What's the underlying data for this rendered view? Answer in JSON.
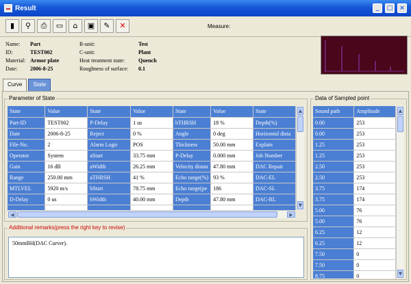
{
  "window": {
    "title": "Result"
  },
  "toolbar": {
    "measure_label": "Measure:"
  },
  "info": {
    "name_label": "Name:",
    "name": "Part",
    "id_label": "ID:",
    "id": "TEST002",
    "material_label": "Material:",
    "material": "Armor plate",
    "date_label": "Date:",
    "date": "2006-8-25",
    "runit_label": "R-unit:",
    "runit": "Test",
    "cunit_label": "C-unit:",
    "cunit": "Plant",
    "heat_label": "Heat treatment state:",
    "heat": "Quench",
    "rough_label": "Roughness of surface:",
    "rough": "0.1"
  },
  "tabs": {
    "curve": "Curve",
    "state": "State"
  },
  "param": {
    "legend": "Parameter of State",
    "headers": [
      "State",
      "Value",
      "State",
      "Value",
      "State",
      "Value",
      "State"
    ],
    "rows": [
      [
        "Part-ID",
        "TEST002",
        "P-Delay",
        "1 us",
        "bTHRSH",
        "18 %",
        "Depth(%)"
      ],
      [
        "Date",
        "2006-8-25",
        "Reject",
        "0 %",
        "Angle",
        "0 deg",
        "Horizontal dista"
      ],
      [
        "File-No.",
        "2",
        "Alarm Logic",
        "POS",
        "Thickness",
        "50.00 mm",
        "Explain"
      ],
      [
        "Operator",
        "System",
        "aStart",
        "33.75 mm",
        "P-Delay",
        "0.000 mm",
        "Job Number"
      ],
      [
        "Gain",
        "16 dB",
        "aWidth",
        "26.25 mm",
        "Velocity distan",
        "47.80 mm",
        "DAC Repair"
      ],
      [
        "Range",
        "250.00 mm",
        "aTHRSH",
        "41 %",
        "Echo range(%)",
        "93 %",
        "DAC-EL"
      ],
      [
        "MTLVEL",
        "5920 m/s",
        "bStart",
        "78.75 mm",
        "Echo range(pe",
        "186",
        "DAC-SL"
      ],
      [
        "D-Delay",
        "0 us",
        "bWidth",
        "40.00 mm",
        "Depth",
        "47.80 mm",
        "DAC-RL"
      ],
      [
        "",
        "",
        "",
        "",
        "",
        "",
        ""
      ]
    ]
  },
  "remarks": {
    "legend": "Additional remarks(press the right key to revise)",
    "text": "50mmBH(DAC Curver)."
  },
  "sampled": {
    "legend": "Data of Sampled point",
    "headers": [
      "Sound path",
      "Amplitude"
    ],
    "rows": [
      [
        "0.00",
        "253"
      ],
      [
        "0.00",
        "253"
      ],
      [
        "1.25",
        "253"
      ],
      [
        "1.25",
        "253"
      ],
      [
        "2.50",
        "253"
      ],
      [
        "2.50",
        "253"
      ],
      [
        "3.75",
        "174"
      ],
      [
        "3.75",
        "174"
      ],
      [
        "5.00",
        "76"
      ],
      [
        "5.00",
        "76"
      ],
      [
        "6.25",
        "12"
      ],
      [
        "6.25",
        "12"
      ],
      [
        "7.50",
        "0"
      ],
      [
        "7.50",
        "0"
      ],
      [
        "8.75",
        "0"
      ]
    ]
  },
  "colors": {
    "accent": "#4b7fd3",
    "title_bar": "#1657d8",
    "remark_text": "#cc0000",
    "waveform": "#7a2a8a"
  },
  "icons": [
    "chart-icon",
    "search-icon",
    "print-icon",
    "folder-icon",
    "home-icon",
    "screen-icon",
    "edit-icon",
    "close-icon"
  ]
}
